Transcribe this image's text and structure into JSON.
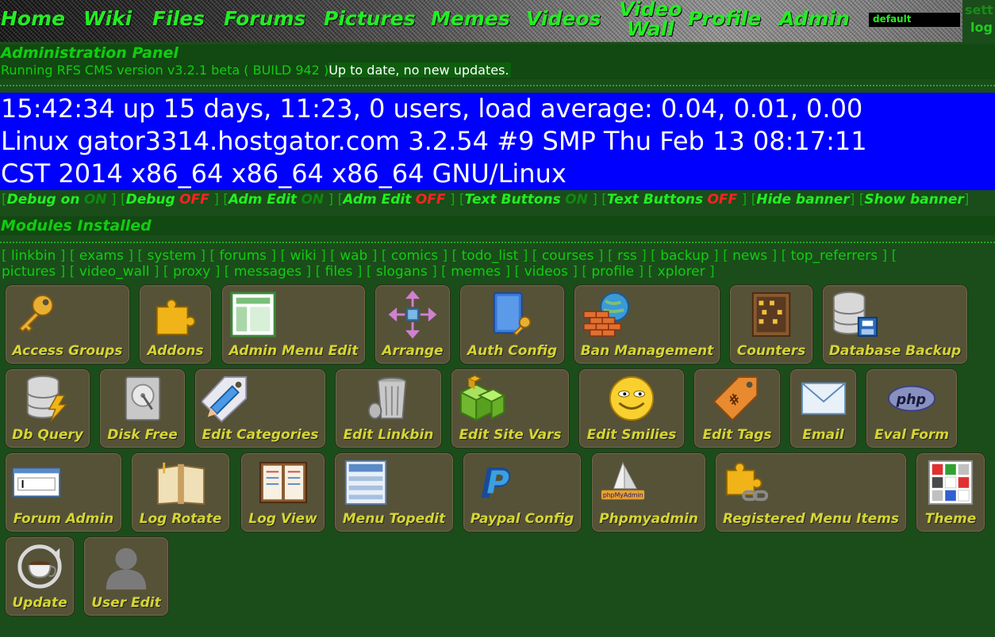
{
  "nav": {
    "links": [
      {
        "label": "Home"
      },
      {
        "label": "Wiki"
      },
      {
        "label": "Files"
      },
      {
        "label": "Forums"
      },
      {
        "label": "Pictures"
      },
      {
        "label": "Memes"
      },
      {
        "label": "Videos"
      },
      {
        "label": "Video Wall",
        "line1": "Video",
        "line2": "Wall"
      },
      {
        "label": "Profile"
      },
      {
        "label": "Admin"
      }
    ],
    "theme_value": "default",
    "login_line1": "sett",
    "login_line2": "log"
  },
  "admin": {
    "title": "Administration Panel",
    "version": "Running RFS CMS version v3.2.1 beta ( BUILD 942 )",
    "update_status": "Up to date, no new updates.",
    "uptime_lines": [
      "15:42:34 up 15 days, 11:23, 0 users, load average: 0.04, 0.01, 0.00",
      "Linux gator3314.hostgator.com 3.2.54 #9 SMP Thu Feb 13 08:17:11",
      "CST 2014 x86_64 x86_64 x86_64 GNU/Linux"
    ],
    "toggles": [
      {
        "label": "Debug on",
        "state": "ON",
        "kind": "on"
      },
      {
        "label": "Debug",
        "state": "OFF",
        "kind": "off"
      },
      {
        "label": "Adm Edit",
        "state": "ON",
        "kind": "on"
      },
      {
        "label": "Adm Edit",
        "state": "OFF",
        "kind": "off"
      },
      {
        "label": "Text Buttons",
        "state": "ON",
        "kind": "on"
      },
      {
        "label": "Text Buttons",
        "state": "OFF",
        "kind": "off"
      },
      {
        "label": "Hide banner",
        "state": "",
        "kind": "none"
      },
      {
        "label": "Show banner",
        "state": "",
        "kind": "none"
      }
    ]
  },
  "modules": {
    "title": "Modules Installed",
    "list": [
      "linkbin",
      "exams",
      "system",
      "forums",
      "wiki",
      "wab",
      "comics",
      "todo_list",
      "courses",
      "rss",
      "backup",
      "news",
      "top_referrers",
      "pictures",
      "video_wall",
      "proxy",
      "messages",
      "files",
      "slogans",
      "memes",
      "videos",
      "profile",
      "xplorer"
    ]
  },
  "tiles": [
    {
      "label": "Access Groups",
      "icon": "key-icon"
    },
    {
      "label": "Addons",
      "icon": "puzzle-icon"
    },
    {
      "label": "Admin Menu Edit",
      "icon": "layout-icon"
    },
    {
      "label": "Arrange",
      "icon": "move-arrows-icon"
    },
    {
      "label": "Auth Config",
      "icon": "book-key-icon"
    },
    {
      "label": "Ban Management",
      "icon": "firewall-icon"
    },
    {
      "label": "Counters",
      "icon": "abacus-icon"
    },
    {
      "label": "Database Backup",
      "icon": "database-save-icon"
    },
    {
      "label": "Db Query",
      "icon": "database-lightning-icon"
    },
    {
      "label": "Disk Free",
      "icon": "hard-disk-icon"
    },
    {
      "label": "Edit Categories",
      "icon": "tag-pencil-icon"
    },
    {
      "label": "Edit Linkbin",
      "icon": "trash-bin-icon"
    },
    {
      "label": "Edit Site Vars",
      "icon": "cubes-icon"
    },
    {
      "label": "Edit Smilies",
      "icon": "smiley-icon"
    },
    {
      "label": "Edit Tags",
      "icon": "price-tag-icon"
    },
    {
      "label": "Email",
      "icon": "envelope-icon"
    },
    {
      "label": "Eval Form",
      "icon": "php-icon"
    },
    {
      "label": "Forum Admin",
      "icon": "text-field-icon"
    },
    {
      "label": "Log Rotate",
      "icon": "open-book-icon"
    },
    {
      "label": "Log View",
      "icon": "ledger-icon"
    },
    {
      "label": "Menu Topedit",
      "icon": "menu-bars-icon"
    },
    {
      "label": "Paypal Config",
      "icon": "paypal-icon"
    },
    {
      "label": "Phpmyadmin",
      "icon": "phpmyadmin-icon"
    },
    {
      "label": "Registered Menu Items",
      "icon": "puzzle-link-icon"
    },
    {
      "label": "Theme",
      "icon": "color-grid-icon"
    },
    {
      "label": "Update",
      "icon": "coffee-refresh-icon"
    },
    {
      "label": "User Edit",
      "icon": "user-silhouette-icon"
    }
  ],
  "colors": {
    "background": "#1a4d1a",
    "accent_green": "#22ee22",
    "tile_bg": "#565238",
    "tile_text": "#d6d633",
    "uptime_bg": "#0000ff",
    "off_red": "#ff2222"
  }
}
